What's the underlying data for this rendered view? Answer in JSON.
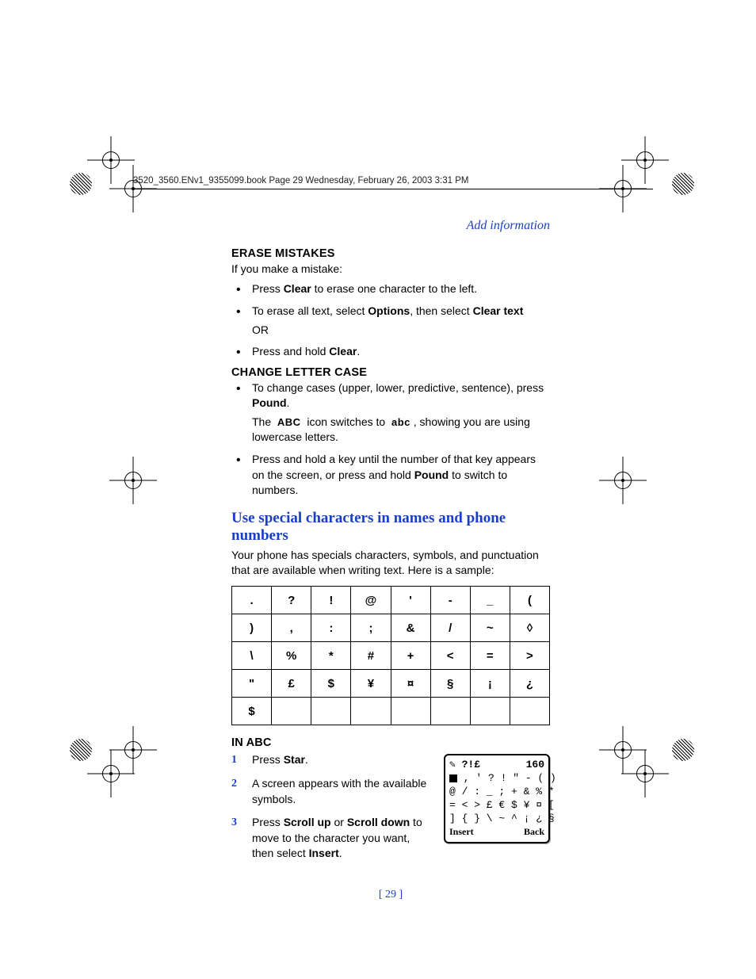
{
  "running_head": "3520_3560.ENv1_9355099.book  Page 29  Wednesday, February 26, 2003  3:31 PM",
  "section_link": "Add information",
  "erase": {
    "heading": "ERASE MISTAKES",
    "intro": "If you make a mistake:",
    "b1_a": "Press ",
    "b1_bold": "Clear",
    "b1_b": " to erase one character to the left.",
    "b2_a": "To erase all text, select ",
    "b2_bold1": "Options",
    "b2_mid": ", then select ",
    "b2_bold2": "Clear text",
    "b2_or": "OR",
    "b3_a": "Press and hold ",
    "b3_bold": "Clear",
    "b3_b": "."
  },
  "case": {
    "heading": "CHANGE LETTER CASE",
    "b1_a": "To change cases (upper, lower, predictive, sentence), press ",
    "b1_bold": "Pound",
    "b1_b": ".",
    "icon_upper": "ABC",
    "icon_lower": "abc",
    "b1_line2a": "The ",
    "b1_line2b": " icon switches to ",
    "b1_line2c": ", showing you are using lowercase letters.",
    "b2_a": "Press and hold a key until the number of that key appears on the screen, or press and hold ",
    "b2_bold": "Pound",
    "b2_b": " to switch to numbers."
  },
  "special": {
    "heading": "Use special characters in names and phone numbers",
    "intro": "Your phone has specials characters, symbols, and punctuation that are available when writing text. Here is a sample:",
    "table": [
      [
        ".",
        "?",
        "!",
        "@",
        "'",
        "-",
        "_",
        "("
      ],
      [
        ")",
        ",",
        ":",
        ";",
        "&",
        "/",
        "~",
        "◊"
      ],
      [
        "\\",
        "%",
        "*",
        "#",
        "+",
        "<",
        "=",
        ">"
      ],
      [
        "\"",
        "£",
        "$",
        "¥",
        "¤",
        "§",
        "¡",
        "¿"
      ],
      [
        "$",
        "",
        "",
        "",
        "",
        "",
        "",
        ""
      ]
    ]
  },
  "inabc": {
    "heading": "IN ABC",
    "s1_a": "Press ",
    "s1_bold": "Star",
    "s1_b": ".",
    "s2": "A screen appears with the available symbols.",
    "s3_a": "Press ",
    "s3_b1": "Scroll up",
    "s3_mid": " or ",
    "s3_b2": "Scroll down",
    "s3_c": " to move to the character you want, then select ",
    "s3_b3": "Insert",
    "s3_d": ".",
    "phone": {
      "top_left": "✎ ?!£",
      "top_right": "160",
      "r1": "■ , ' ? ! \" - ( )",
      "r2": "@ / : _ ; + & % *",
      "r3": "= < > £ € $ ¥ ¤ [",
      "r4": "] { } \\ ~ ^ ¡ ¿ §",
      "insert": "Insert",
      "back": "Back"
    }
  },
  "page_number": "[ 29 ]"
}
